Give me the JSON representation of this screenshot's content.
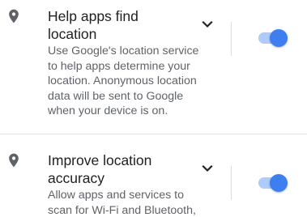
{
  "colors": {
    "accent": "#3d7ff0",
    "accent_track": "#aecbfa",
    "title_text": "#202124",
    "summary_text": "#5f6368",
    "icon": "#5f6368",
    "divider": "#e0e0e0"
  },
  "settings": [
    {
      "icon": "location-pin-icon",
      "title_line1": "Help apps find",
      "title_line2": "location",
      "summary_lines": [
        "Use Google's location service",
        "to help apps determine your",
        "location. Anonymous location",
        "data will be sent to Google",
        "when your device is on."
      ],
      "expand_icon": "chevron-down-icon",
      "toggle_on": true
    },
    {
      "icon": "location-pin-icon",
      "title_line1": "Improve location",
      "title_line2": "accuracy",
      "summary_lines": [
        "Allow apps and services to",
        "scan for Wi-Fi and Bluetooth,"
      ],
      "expand_icon": "chevron-down-icon",
      "toggle_on": true
    }
  ]
}
